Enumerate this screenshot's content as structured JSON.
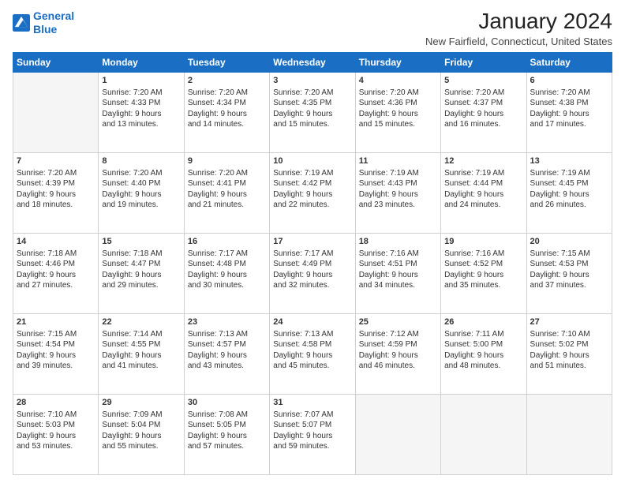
{
  "header": {
    "logo_line1": "General",
    "logo_line2": "Blue",
    "title": "January 2024",
    "subtitle": "New Fairfield, Connecticut, United States"
  },
  "weekdays": [
    "Sunday",
    "Monday",
    "Tuesday",
    "Wednesday",
    "Thursday",
    "Friday",
    "Saturday"
  ],
  "weeks": [
    [
      {
        "num": "",
        "empty": true
      },
      {
        "num": "1",
        "sunrise": "7:20 AM",
        "sunset": "4:33 PM",
        "daylight": "9 hours and 13 minutes."
      },
      {
        "num": "2",
        "sunrise": "7:20 AM",
        "sunset": "4:34 PM",
        "daylight": "9 hours and 14 minutes."
      },
      {
        "num": "3",
        "sunrise": "7:20 AM",
        "sunset": "4:35 PM",
        "daylight": "9 hours and 15 minutes."
      },
      {
        "num": "4",
        "sunrise": "7:20 AM",
        "sunset": "4:36 PM",
        "daylight": "9 hours and 15 minutes."
      },
      {
        "num": "5",
        "sunrise": "7:20 AM",
        "sunset": "4:37 PM",
        "daylight": "9 hours and 16 minutes."
      },
      {
        "num": "6",
        "sunrise": "7:20 AM",
        "sunset": "4:38 PM",
        "daylight": "9 hours and 17 minutes."
      }
    ],
    [
      {
        "num": "7",
        "sunrise": "7:20 AM",
        "sunset": "4:39 PM",
        "daylight": "9 hours and 18 minutes."
      },
      {
        "num": "8",
        "sunrise": "7:20 AM",
        "sunset": "4:40 PM",
        "daylight": "9 hours and 19 minutes."
      },
      {
        "num": "9",
        "sunrise": "7:20 AM",
        "sunset": "4:41 PM",
        "daylight": "9 hours and 21 minutes."
      },
      {
        "num": "10",
        "sunrise": "7:19 AM",
        "sunset": "4:42 PM",
        "daylight": "9 hours and 22 minutes."
      },
      {
        "num": "11",
        "sunrise": "7:19 AM",
        "sunset": "4:43 PM",
        "daylight": "9 hours and 23 minutes."
      },
      {
        "num": "12",
        "sunrise": "7:19 AM",
        "sunset": "4:44 PM",
        "daylight": "9 hours and 24 minutes."
      },
      {
        "num": "13",
        "sunrise": "7:19 AM",
        "sunset": "4:45 PM",
        "daylight": "9 hours and 26 minutes."
      }
    ],
    [
      {
        "num": "14",
        "sunrise": "7:18 AM",
        "sunset": "4:46 PM",
        "daylight": "9 hours and 27 minutes."
      },
      {
        "num": "15",
        "sunrise": "7:18 AM",
        "sunset": "4:47 PM",
        "daylight": "9 hours and 29 minutes."
      },
      {
        "num": "16",
        "sunrise": "7:17 AM",
        "sunset": "4:48 PM",
        "daylight": "9 hours and 30 minutes."
      },
      {
        "num": "17",
        "sunrise": "7:17 AM",
        "sunset": "4:49 PM",
        "daylight": "9 hours and 32 minutes."
      },
      {
        "num": "18",
        "sunrise": "7:16 AM",
        "sunset": "4:51 PM",
        "daylight": "9 hours and 34 minutes."
      },
      {
        "num": "19",
        "sunrise": "7:16 AM",
        "sunset": "4:52 PM",
        "daylight": "9 hours and 35 minutes."
      },
      {
        "num": "20",
        "sunrise": "7:15 AM",
        "sunset": "4:53 PM",
        "daylight": "9 hours and 37 minutes."
      }
    ],
    [
      {
        "num": "21",
        "sunrise": "7:15 AM",
        "sunset": "4:54 PM",
        "daylight": "9 hours and 39 minutes."
      },
      {
        "num": "22",
        "sunrise": "7:14 AM",
        "sunset": "4:55 PM",
        "daylight": "9 hours and 41 minutes."
      },
      {
        "num": "23",
        "sunrise": "7:13 AM",
        "sunset": "4:57 PM",
        "daylight": "9 hours and 43 minutes."
      },
      {
        "num": "24",
        "sunrise": "7:13 AM",
        "sunset": "4:58 PM",
        "daylight": "9 hours and 45 minutes."
      },
      {
        "num": "25",
        "sunrise": "7:12 AM",
        "sunset": "4:59 PM",
        "daylight": "9 hours and 46 minutes."
      },
      {
        "num": "26",
        "sunrise": "7:11 AM",
        "sunset": "5:00 PM",
        "daylight": "9 hours and 48 minutes."
      },
      {
        "num": "27",
        "sunrise": "7:10 AM",
        "sunset": "5:02 PM",
        "daylight": "9 hours and 51 minutes."
      }
    ],
    [
      {
        "num": "28",
        "sunrise": "7:10 AM",
        "sunset": "5:03 PM",
        "daylight": "9 hours and 53 minutes."
      },
      {
        "num": "29",
        "sunrise": "7:09 AM",
        "sunset": "5:04 PM",
        "daylight": "9 hours and 55 minutes."
      },
      {
        "num": "30",
        "sunrise": "7:08 AM",
        "sunset": "5:05 PM",
        "daylight": "9 hours and 57 minutes."
      },
      {
        "num": "31",
        "sunrise": "7:07 AM",
        "sunset": "5:07 PM",
        "daylight": "9 hours and 59 minutes."
      },
      {
        "num": "",
        "empty": true
      },
      {
        "num": "",
        "empty": true
      },
      {
        "num": "",
        "empty": true
      }
    ]
  ],
  "labels": {
    "sunrise": "Sunrise:",
    "sunset": "Sunset:",
    "daylight": "Daylight:"
  }
}
